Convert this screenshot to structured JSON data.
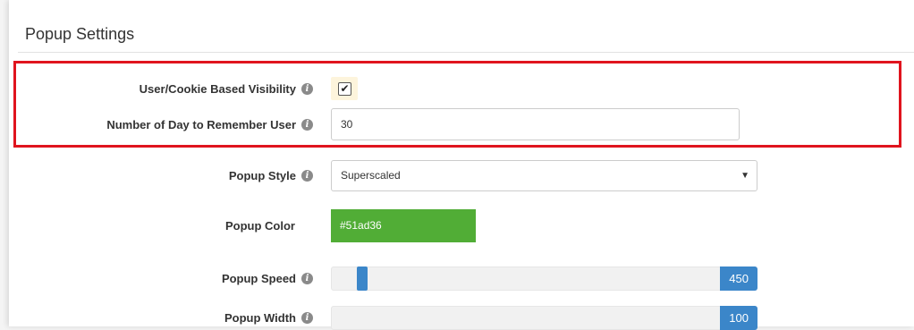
{
  "panel": {
    "title": "Popup Settings"
  },
  "fields": {
    "visibility": {
      "label": "User/Cookie Based Visibility",
      "checked": true,
      "check_mark": "✔"
    },
    "remember_days": {
      "label": "Number of Day to Remember User",
      "value": "30"
    },
    "style": {
      "label": "Popup Style",
      "selected": "Superscaled",
      "arrow": "▼"
    },
    "color": {
      "label": "Popup Color",
      "value": "#51ad36"
    },
    "speed": {
      "label": "Popup Speed",
      "value": "450",
      "fraction": 0.08
    },
    "width": {
      "label": "Popup Width",
      "value": "100",
      "fraction": 1.0
    }
  },
  "info_icon": "i",
  "colors": {
    "highlight": "#e0141e",
    "accent": "#3b86c9",
    "popup_color": "#51ad36"
  }
}
